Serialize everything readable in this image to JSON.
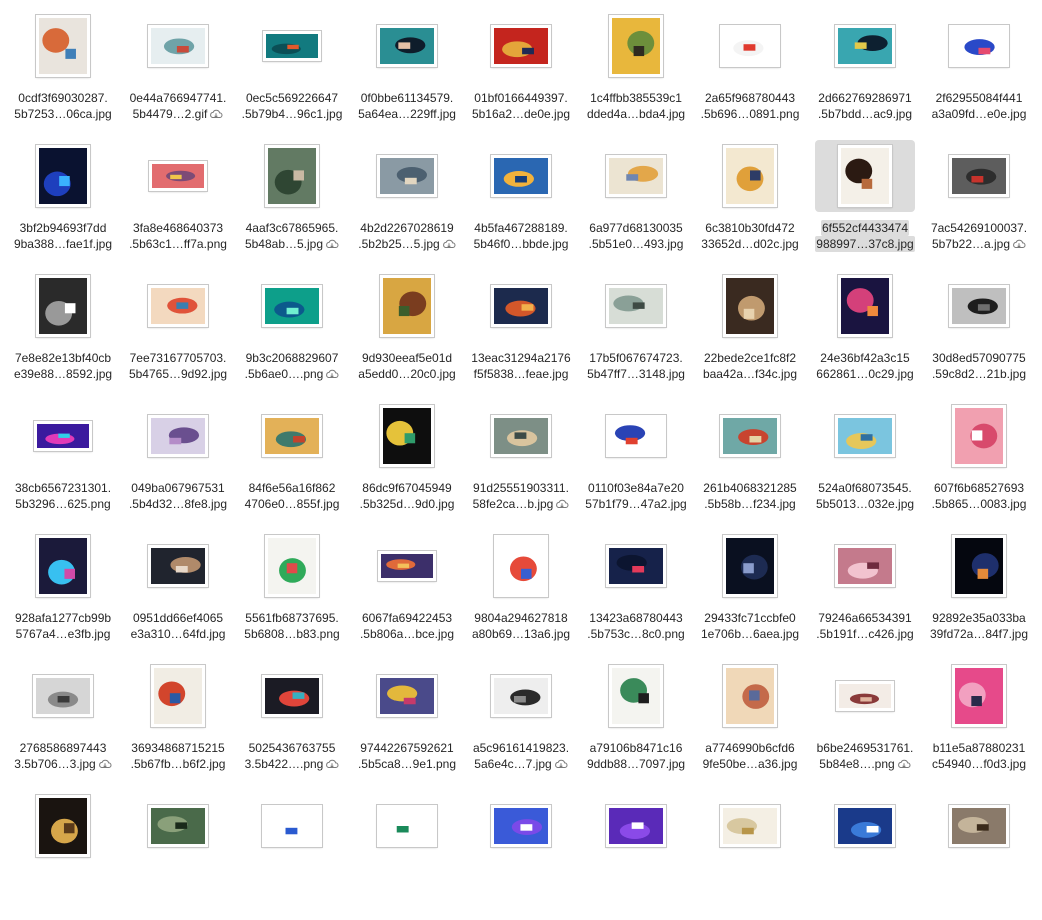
{
  "colors": {
    "selection": "#dcdcdc",
    "text": "#262626",
    "thumb_border": "#c8c8c8"
  },
  "files": [
    {
      "l1": "0cdf3f69030287.",
      "l2": "5b7253…06ca.jpg",
      "o": "p",
      "c": [
        "#e9e4dd",
        "#d86a3a",
        "#3f7fb8"
      ]
    },
    {
      "l1": "0e44a766947741.",
      "l2": "5b4479…2.gif",
      "cloud": true,
      "o": "l",
      "c": [
        "#e6eef0",
        "#6fa3a8",
        "#c94a3a"
      ]
    },
    {
      "l1": "0ec5c569226647",
      "l2": ".5b79b4…96c1.jpg",
      "o": "w",
      "c": [
        "#127a7f",
        "#0b4f56",
        "#e3592b"
      ]
    },
    {
      "l1": "0f0bbe61134579.",
      "l2": "5a64ea…229ff.jpg",
      "o": "l",
      "c": [
        "#2a8e93",
        "#0e1d2b",
        "#e4c0a6"
      ]
    },
    {
      "l1": "01bf0166449397.",
      "l2": "5b16a2…de0e.jpg",
      "o": "l",
      "c": [
        "#c4251e",
        "#e4a53a",
        "#1f2a55"
      ]
    },
    {
      "l1": "1c4ffbb385539c1",
      "l2": "dded4a…bda4.jpg",
      "o": "p",
      "c": [
        "#e8b73c",
        "#6d8f3b",
        "#2f2b20"
      ]
    },
    {
      "l1": "2a65f968780443",
      "l2": ".5b696…0891.png",
      "o": "l",
      "c": [
        "#ffffff",
        "#f4f4f4",
        "#e03a2e"
      ]
    },
    {
      "l1": "2d662769286971",
      "l2": ".5b7bdd…ac9.jpg",
      "o": "l",
      "c": [
        "#39a6b0",
        "#0d2030",
        "#e2c94b"
      ]
    },
    {
      "l1": "2f62955084f441",
      "l2": "a3a09fd…e0e.jpg",
      "o": "l",
      "c": [
        "#ffffff",
        "#2a49c8",
        "#e64a6f"
      ]
    },
    {
      "l1": "3bf2b94693f7dd",
      "l2": "9ba388…fae1f.jpg",
      "o": "p",
      "c": [
        "#0a1230",
        "#1e3fbd",
        "#3ab2ff"
      ]
    },
    {
      "l1": "3fa8e468640373",
      "l2": ".5b63c1…ff7a.png",
      "o": "w",
      "c": [
        "#e26c6f",
        "#7d4b76",
        "#f1c64a"
      ]
    },
    {
      "l1": "4aaf3c67865965.",
      "l2": "5b48ab…5.jpg",
      "cloud": true,
      "o": "p",
      "c": [
        "#627a63",
        "#2f4633",
        "#c9b9a3"
      ]
    },
    {
      "l1": "4b2d2267028619",
      "l2": ".5b2b25…5.jpg",
      "cloud": true,
      "o": "l",
      "c": [
        "#8a9aa4",
        "#4c6070",
        "#e2d6c0"
      ]
    },
    {
      "l1": "4b5fa467288189.",
      "l2": "5b46f0…bbde.jpg",
      "o": "l",
      "c": [
        "#2a67b2",
        "#f2b23c",
        "#153d7a"
      ]
    },
    {
      "l1": "6a977d68130035",
      "l2": ".5b51e0…493.jpg",
      "o": "l",
      "c": [
        "#ece4d2",
        "#e3a74a",
        "#6f86b1"
      ]
    },
    {
      "l1": "6c3810b30fd472",
      "l2": "33652d…d02c.jpg",
      "o": "p",
      "c": [
        "#f3e8d0",
        "#e0a03a",
        "#2d3c66"
      ]
    },
    {
      "l1": "6f552cf4433474",
      "l2": "988997…37c8.jpg",
      "o": "p",
      "sel": true,
      "c": [
        "#f4f0e8",
        "#2b1a12",
        "#b76a3c"
      ]
    },
    {
      "l1": "7ac54269100037.",
      "l2": "5b7b22…a.jpg",
      "cloud": true,
      "o": "l",
      "c": [
        "#5d5d5d",
        "#2d2d2d",
        "#c7332c"
      ]
    },
    {
      "l1": "7e8e82e13bf40cb",
      "l2": "e39e88…8592.jpg",
      "o": "p",
      "c": [
        "#2a2a2a",
        "#999999",
        "#ffffff"
      ]
    },
    {
      "l1": "7ee73167705703.",
      "l2": "5b4765…9d92.jpg",
      "o": "l",
      "c": [
        "#f3d9bf",
        "#e0533a",
        "#3a7fb0"
      ]
    },
    {
      "l1": "9b3c2068829607",
      "l2": ".5b6ae0….png",
      "cloud": true,
      "o": "l",
      "c": [
        "#0d9f8a",
        "#0c5a8c",
        "#6ff0d0"
      ]
    },
    {
      "l1": "9d930eeaf5e01d",
      "l2": "a5edd0…20c0.jpg",
      "o": "p",
      "c": [
        "#d8a642",
        "#7a3d1f",
        "#3b5e2c"
      ]
    },
    {
      "l1": "13eac31294a2176",
      "l2": "f5f5838…feae.jpg",
      "o": "l",
      "c": [
        "#1c2a4d",
        "#d3572a",
        "#f2b04c"
      ]
    },
    {
      "l1": "17b5f067674723.",
      "l2": "5b47ff7…3148.jpg",
      "o": "l",
      "c": [
        "#d7ddd6",
        "#8aa097",
        "#3d4a44"
      ]
    },
    {
      "l1": "22bede2ce1fc8f2",
      "l2": "baa42a…f34c.jpg",
      "o": "p",
      "c": [
        "#3a2a20",
        "#c09a6e",
        "#e8d2ae"
      ]
    },
    {
      "l1": "24e36bf42a3c15",
      "l2": "662861…0c29.jpg",
      "o": "p",
      "c": [
        "#1a1440",
        "#d4407a",
        "#f08a3c"
      ]
    },
    {
      "l1": "30d8ed57090775",
      "l2": ".59c8d2…21b.jpg",
      "o": "l",
      "c": [
        "#bfbfbf",
        "#1e1e1e",
        "#6e6e6e"
      ]
    },
    {
      "l1": "38cb6567231301.",
      "l2": "5b3296…625.png",
      "o": "w",
      "c": [
        "#3b1a9e",
        "#e23ab8",
        "#2fd0e8"
      ]
    },
    {
      "l1": "049ba067967531",
      "l2": ".5b4d32…8fe8.jpg",
      "o": "l",
      "c": [
        "#d8d0e6",
        "#6a4f8f",
        "#b48cc8"
      ]
    },
    {
      "l1": "84f6e56a16f862",
      "l2": "4706e0…855f.jpg",
      "o": "l",
      "c": [
        "#e3b158",
        "#3f7a6c",
        "#c4432c"
      ]
    },
    {
      "l1": "86dc9f67045949",
      "l2": ".5b325d…9d0.jpg",
      "o": "p",
      "c": [
        "#0e0e0e",
        "#e5c23a",
        "#2f9c6b"
      ]
    },
    {
      "l1": "91d25551903311.",
      "l2": "58fe2ca…b.jpg",
      "cloud": true,
      "o": "l",
      "c": [
        "#7d8f86",
        "#d9c49e",
        "#3d4b47"
      ]
    },
    {
      "l1": "0110f03e84a7e20",
      "l2": "57b1f79…47a2.jpg",
      "o": "l",
      "c": [
        "#ffffff",
        "#2a43b5",
        "#e0402f"
      ]
    },
    {
      "l1": "261b4068321285",
      "l2": ".5b58b…f234.jpg",
      "o": "l",
      "c": [
        "#6fa8a6",
        "#c8442f",
        "#e6d3a5"
      ]
    },
    {
      "l1": "524a0f68073545.",
      "l2": "5b5013…032e.jpg",
      "o": "l",
      "c": [
        "#7bc5df",
        "#e6c75a",
        "#2e6fa1"
      ]
    },
    {
      "l1": "607f6b68527693",
      "l2": ".5b865…0083.jpg",
      "o": "p",
      "c": [
        "#f1a0b0",
        "#d84a6c",
        "#ffffff"
      ]
    },
    {
      "l1": "928afa1277cb99b",
      "l2": "5767a4…e3fb.jpg",
      "o": "p",
      "c": [
        "#1b1a3a",
        "#38c0f0",
        "#d14aa8"
      ]
    },
    {
      "l1": "0951dd66ef4065",
      "l2": "e3a310…64fd.jpg",
      "o": "l",
      "c": [
        "#20242e",
        "#b08a6a",
        "#e8d8c8"
      ]
    },
    {
      "l1": "5561fb68737695.",
      "l2": "5b6808…b83.png",
      "o": "p",
      "c": [
        "#f4f4f0",
        "#2faa5a",
        "#e04a4a"
      ]
    },
    {
      "l1": "6067fa69422453",
      "l2": ".5b806a…bce.jpg",
      "o": "w",
      "c": [
        "#3c2f6a",
        "#e06a3a",
        "#f3c05a"
      ]
    },
    {
      "l1": "9804a294627818",
      "l2": "a80b69…13a6.jpg",
      "o": "p",
      "c": [
        "#ffffff",
        "#e64a3a",
        "#3a5fd0"
      ]
    },
    {
      "l1": "13423a68780443",
      "l2": ".5b753c…8c0.png",
      "o": "l",
      "c": [
        "#16224a",
        "#0c1530",
        "#e33a5a"
      ]
    },
    {
      "l1": "29433fc71ccbfe0",
      "l2": "1e706b…6aea.jpg",
      "o": "p",
      "c": [
        "#0a1020",
        "#1d2b52",
        "#8a9ccc"
      ]
    },
    {
      "l1": "79246a66534391",
      "l2": ".5b191f…c426.jpg",
      "o": "l",
      "c": [
        "#c47a8c",
        "#f2c3cf",
        "#6e2a3e"
      ]
    },
    {
      "l1": "92892e35a033ba",
      "l2": "39fd72a…84f7.jpg",
      "o": "p",
      "c": [
        "#05070f",
        "#1e2f6c",
        "#e48a3a"
      ]
    },
    {
      "l1": "2768586897443",
      "l2": "3.5b706…3.jpg",
      "cloud": true,
      "o": "l",
      "c": [
        "#d6d6d6",
        "#8a8a8a",
        "#3a3a3a"
      ]
    },
    {
      "l1": "36934868715215",
      "l2": ".5b67fb…b6f2.jpg",
      "o": "p",
      "c": [
        "#f1ede4",
        "#d2452c",
        "#2a5aa6"
      ]
    },
    {
      "l1": "5025436763755",
      "l2": "3.5b422….png",
      "cloud": true,
      "o": "l",
      "c": [
        "#1b1b24",
        "#e0453a",
        "#37b0c0"
      ]
    },
    {
      "l1": "97442267592621",
      "l2": ".5b5ca8…9e1.png",
      "o": "l",
      "c": [
        "#4a4a8a",
        "#e3b83c",
        "#c63a6a"
      ]
    },
    {
      "l1": "a5c96161419823.",
      "l2": "5a6e4c…7.jpg",
      "cloud": true,
      "o": "l",
      "c": [
        "#eeeeee",
        "#2a2a2a",
        "#8a8a8a"
      ]
    },
    {
      "l1": "a79106b8471c16",
      "l2": "9ddb88…7097.jpg",
      "o": "p",
      "c": [
        "#f4f4f0",
        "#3a8a5a",
        "#1e1e1e"
      ]
    },
    {
      "l1": "a7746990b6cfd6",
      "l2": "9fe50be…a36.jpg",
      "o": "p",
      "c": [
        "#f0d8b8",
        "#c46a4a",
        "#5a6a9a"
      ]
    },
    {
      "l1": "b6be2469531761.",
      "l2": "5b84e8….png",
      "cloud": true,
      "o": "w",
      "c": [
        "#f3ece6",
        "#8a3a3a",
        "#e2b6a0"
      ]
    },
    {
      "l1": "b11e5a87880231",
      "l2": "c54940…f0d3.jpg",
      "o": "p",
      "c": [
        "#e64a8a",
        "#f2a0c0",
        "#2a2a4a"
      ]
    },
    {
      "l1": "",
      "l2": "",
      "o": "p",
      "c": [
        "#1a1410",
        "#d6a64a",
        "#5a3a1a"
      ]
    },
    {
      "l1": "",
      "l2": "",
      "o": "l",
      "c": [
        "#4a6a4a",
        "#8aa07a",
        "#1a2a1a"
      ]
    },
    {
      "l1": "",
      "l2": "",
      "o": "l",
      "c": [
        "#ffffff",
        "#ffffff",
        "#2a5ad0"
      ]
    },
    {
      "l1": "",
      "l2": "",
      "o": "l",
      "c": [
        "#ffffff",
        "#ffffff",
        "#1a8a5a"
      ]
    },
    {
      "l1": "",
      "l2": "",
      "o": "l",
      "c": [
        "#3a5ad8",
        "#7a4ae8",
        "#ffffff"
      ]
    },
    {
      "l1": "",
      "l2": "",
      "o": "l",
      "c": [
        "#5a2ab8",
        "#8a4ae8",
        "#ffffff"
      ]
    },
    {
      "l1": "",
      "l2": "",
      "o": "l",
      "c": [
        "#f4efe4",
        "#d8c8a0",
        "#b8964a"
      ]
    },
    {
      "l1": "",
      "l2": "",
      "o": "l",
      "c": [
        "#1a3a8a",
        "#3a7ad8",
        "#ffffff"
      ]
    },
    {
      "l1": "",
      "l2": "",
      "o": "l",
      "c": [
        "#8a7a6a",
        "#c4b49a",
        "#3a2a1a"
      ]
    }
  ]
}
